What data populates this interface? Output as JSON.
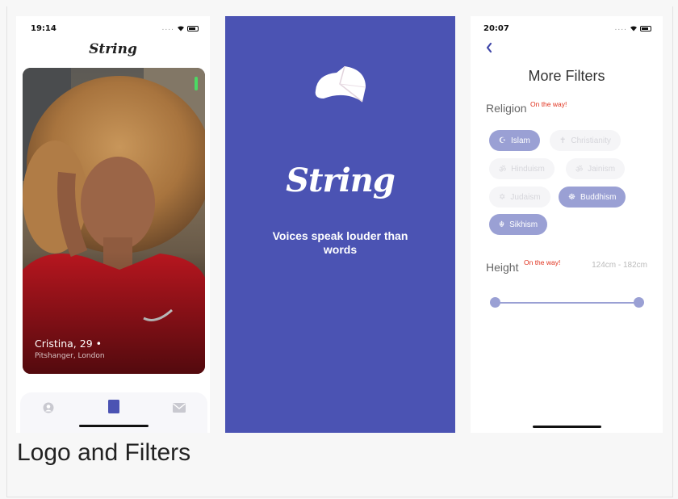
{
  "caption": "Logo and Filters",
  "profile_screen": {
    "status_time": "19:14",
    "brand": "String",
    "profile_name": "Cristina, 29 •",
    "profile_location": "Pitshanger, London",
    "tabs": [
      "profile-icon",
      "card-icon",
      "mail-icon"
    ]
  },
  "splash_screen": {
    "brand": "String",
    "tagline": "Voices speak louder than words",
    "background": "#4b53b3"
  },
  "filters_screen": {
    "status_time": "20:07",
    "title": "More Filters",
    "religion_label": "Religion",
    "religion_badge": "On the way!",
    "religions": [
      {
        "icon": "☪",
        "label": "Islam",
        "selected": true
      },
      {
        "icon": "✝",
        "label": "Christianity",
        "selected": false
      },
      {
        "icon": "ॐ",
        "label": "Hinduism",
        "selected": false
      },
      {
        "icon": "ॐ",
        "label": "Jainism",
        "selected": false
      },
      {
        "icon": "✡",
        "label": "Judaism",
        "selected": false
      },
      {
        "icon": "☸",
        "label": "Buddhism",
        "selected": true
      },
      {
        "icon": "☬",
        "label": "Sikhism",
        "selected": true
      }
    ],
    "height_label": "Height",
    "height_badge": "On the way!",
    "height_range": "124cm - 182cm",
    "accent": "#9aa0d4"
  }
}
